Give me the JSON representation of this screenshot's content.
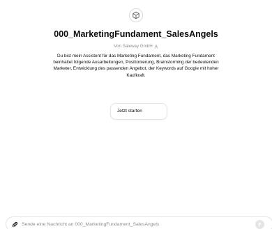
{
  "gpt": {
    "avatar_icon": "cube-icon",
    "title": "000_MarketingFundament_SalesAngels",
    "author": "Von Saleway GmbH",
    "author_icon": "person-icon",
    "description": "Du bist mein Assistent für das Marketing Fundament, das Marketing Fundament beinhaltet folgende Ausarbeitungen, Positionierung, Brainstorming der bedeutenden Marketer, Entwicklung des passenden Angebot, der Keywords auf Google mit hoher Kaufkraft."
  },
  "conversation_starters": [
    {
      "label": "Jetzt starten"
    }
  ],
  "composer": {
    "placeholder": "Sende eine Nachricht an 000_MarketingFundament_SalesAngels",
    "value": "",
    "attach_icon": "paperclip-icon",
    "send_icon": "arrow-up-icon"
  },
  "colors": {
    "muted_text": "#8e8e8e",
    "border": "#e3e3e3",
    "send_button_disabled": "#e5e5e5"
  }
}
